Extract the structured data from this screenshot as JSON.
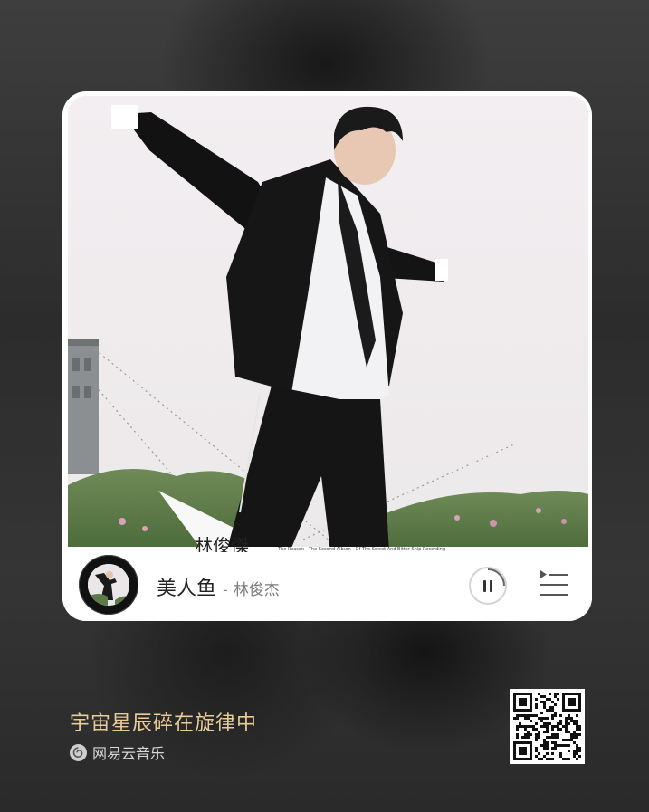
{
  "player": {
    "song_title": "美人鱼",
    "separator": "-",
    "artist": "林俊杰"
  },
  "footer": {
    "tagline": "宇宙星辰碎在旋律中",
    "brand": "网易云音乐"
  },
  "icons": {
    "play_state": "pause-icon",
    "playlist": "playlist-icon",
    "brand_logo": "netease-music-logo",
    "qr": "qr-code"
  },
  "colors": {
    "tagline": "#e8cb97",
    "card": "#ffffff",
    "background": "#333333"
  }
}
